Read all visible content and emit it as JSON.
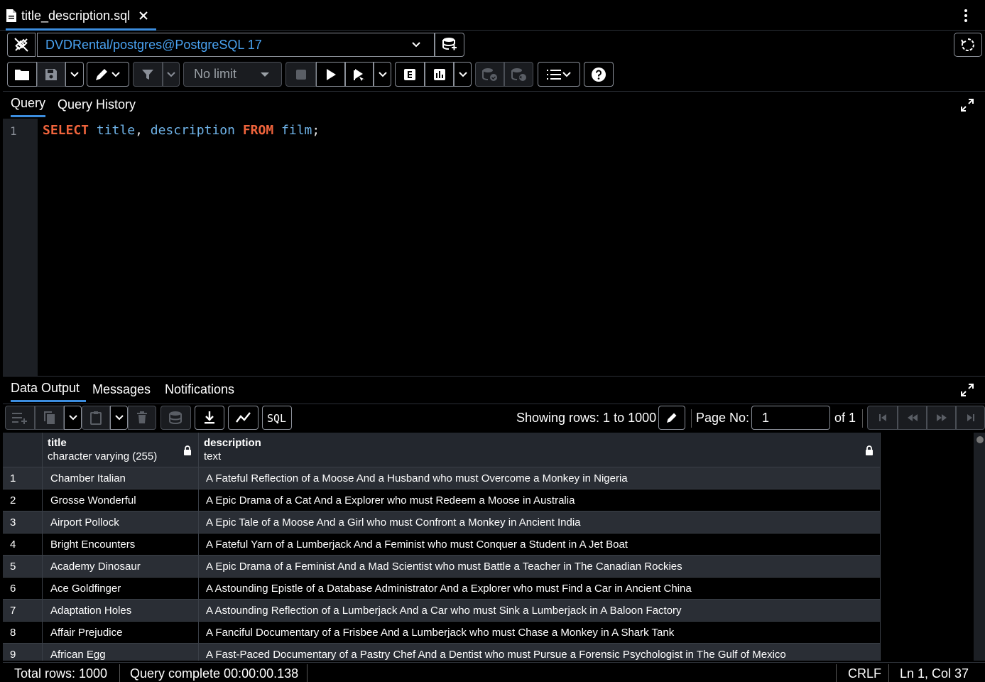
{
  "tab": {
    "title": "title_description.sql"
  },
  "connection": {
    "label": "DVDRental/postgres@PostgreSQL 17"
  },
  "toolbar": {
    "limit_label": "No limit"
  },
  "editor": {
    "line_number": "1",
    "tokens": {
      "select": "SELECT",
      "col1": "title",
      "comma": ",",
      "col2": "description",
      "from": "FROM",
      "table": "film",
      "semi": ";"
    }
  },
  "query_tabs": [
    "Query",
    "Query History"
  ],
  "output_tabs": [
    "Data Output",
    "Messages",
    "Notifications"
  ],
  "pagination": {
    "showing": "Showing rows: 1 to 1000",
    "page_label": "Page No:",
    "page_value": "1",
    "of_label": "of 1"
  },
  "grid": {
    "columns": [
      {
        "name": "title",
        "type": "character varying (255)"
      },
      {
        "name": "description",
        "type": "text"
      }
    ],
    "rows": [
      {
        "n": "1",
        "title": "Chamber Italian",
        "description": "A Fateful Reflection of a Moose And a Husband who must Overcome a Monkey in Nigeria"
      },
      {
        "n": "2",
        "title": "Grosse Wonderful",
        "description": "A Epic Drama of a Cat And a Explorer who must Redeem a Moose in Australia"
      },
      {
        "n": "3",
        "title": "Airport Pollock",
        "description": "A Epic Tale of a Moose And a Girl who must Confront a Monkey in Ancient India"
      },
      {
        "n": "4",
        "title": "Bright Encounters",
        "description": "A Fateful Yarn of a Lumberjack And a Feminist who must Conquer a Student in A Jet Boat"
      },
      {
        "n": "5",
        "title": "Academy Dinosaur",
        "description": "A Epic Drama of a Feminist And a Mad Scientist who must Battle a Teacher in The Canadian Rockies"
      },
      {
        "n": "6",
        "title": "Ace Goldfinger",
        "description": "A Astounding Epistle of a Database Administrator And a Explorer who must Find a Car in Ancient China"
      },
      {
        "n": "7",
        "title": "Adaptation Holes",
        "description": "A Astounding Reflection of a Lumberjack And a Car who must Sink a Lumberjack in A Baloon Factory"
      },
      {
        "n": "8",
        "title": "Affair Prejudice",
        "description": "A Fanciful Documentary of a Frisbee And a Lumberjack who must Chase a Monkey in A Shark Tank"
      },
      {
        "n": "9",
        "title": "African Egg",
        "description": "A Fast-Paced Documentary of a Pastry Chef And a Dentist who must Pursue a Forensic Psychologist in The Gulf of Mexico"
      }
    ]
  },
  "status": {
    "total": "Total rows: 1000",
    "query": "Query complete 00:00:00.138",
    "eol": "CRLF",
    "position": "Ln 1, Col 37"
  }
}
